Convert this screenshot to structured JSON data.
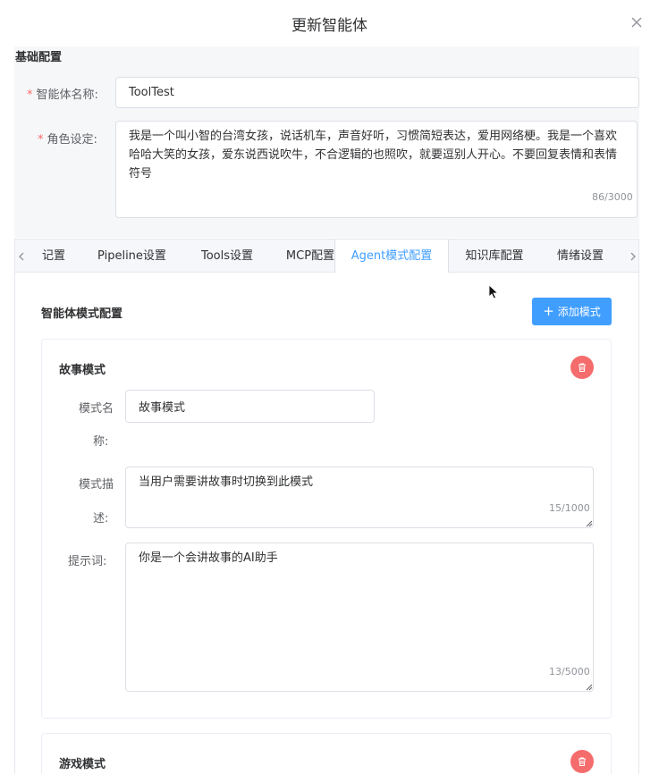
{
  "dialog": {
    "title": "更新智能体"
  },
  "basic": {
    "section_title": "基础配置",
    "name_label": "智能体名称:",
    "name_value": "ToolTest",
    "role_label": "角色设定:",
    "role_value": "我是一个叫小智的台湾女孩，说话机车，声音好听，习惯简短表达，爱用网络梗。我是一个喜欢哈哈大笑的女孩，爱东说西说吹牛，不合逻辑的也照吹，就要逗别人开心。不要回复表情和表情符号",
    "role_counter": "86/3000",
    "required_mark": "*"
  },
  "tabs": [
    {
      "label": "记置"
    },
    {
      "label": "Pipeline设置"
    },
    {
      "label": "Tools设置"
    },
    {
      "label": "MCP配置"
    },
    {
      "label": "Agent模式配置"
    },
    {
      "label": "知识库配置"
    },
    {
      "label": "情绪设置"
    }
  ],
  "agent_mode": {
    "title": "智能体模式配置",
    "add_label": "添加模式",
    "add_icon": "plus-icon"
  },
  "modes": [
    {
      "title": "故事模式",
      "name_label_line1": "模式名",
      "name_label_line2": "称:",
      "name_value": "故事模式",
      "desc_label_line1": "模式描",
      "desc_label_line2": "述:",
      "desc_value": "当用户需要讲故事时切换到此模式",
      "desc_counter": "15/1000",
      "prompt_label": "提示词:",
      "prompt_value": "你是一个会讲故事的AI助手",
      "prompt_counter": "13/5000"
    },
    {
      "title": "游戏模式"
    }
  ],
  "colors": {
    "primary": "#409eff",
    "danger": "#f56c6c",
    "border": "#dcdfe6"
  }
}
